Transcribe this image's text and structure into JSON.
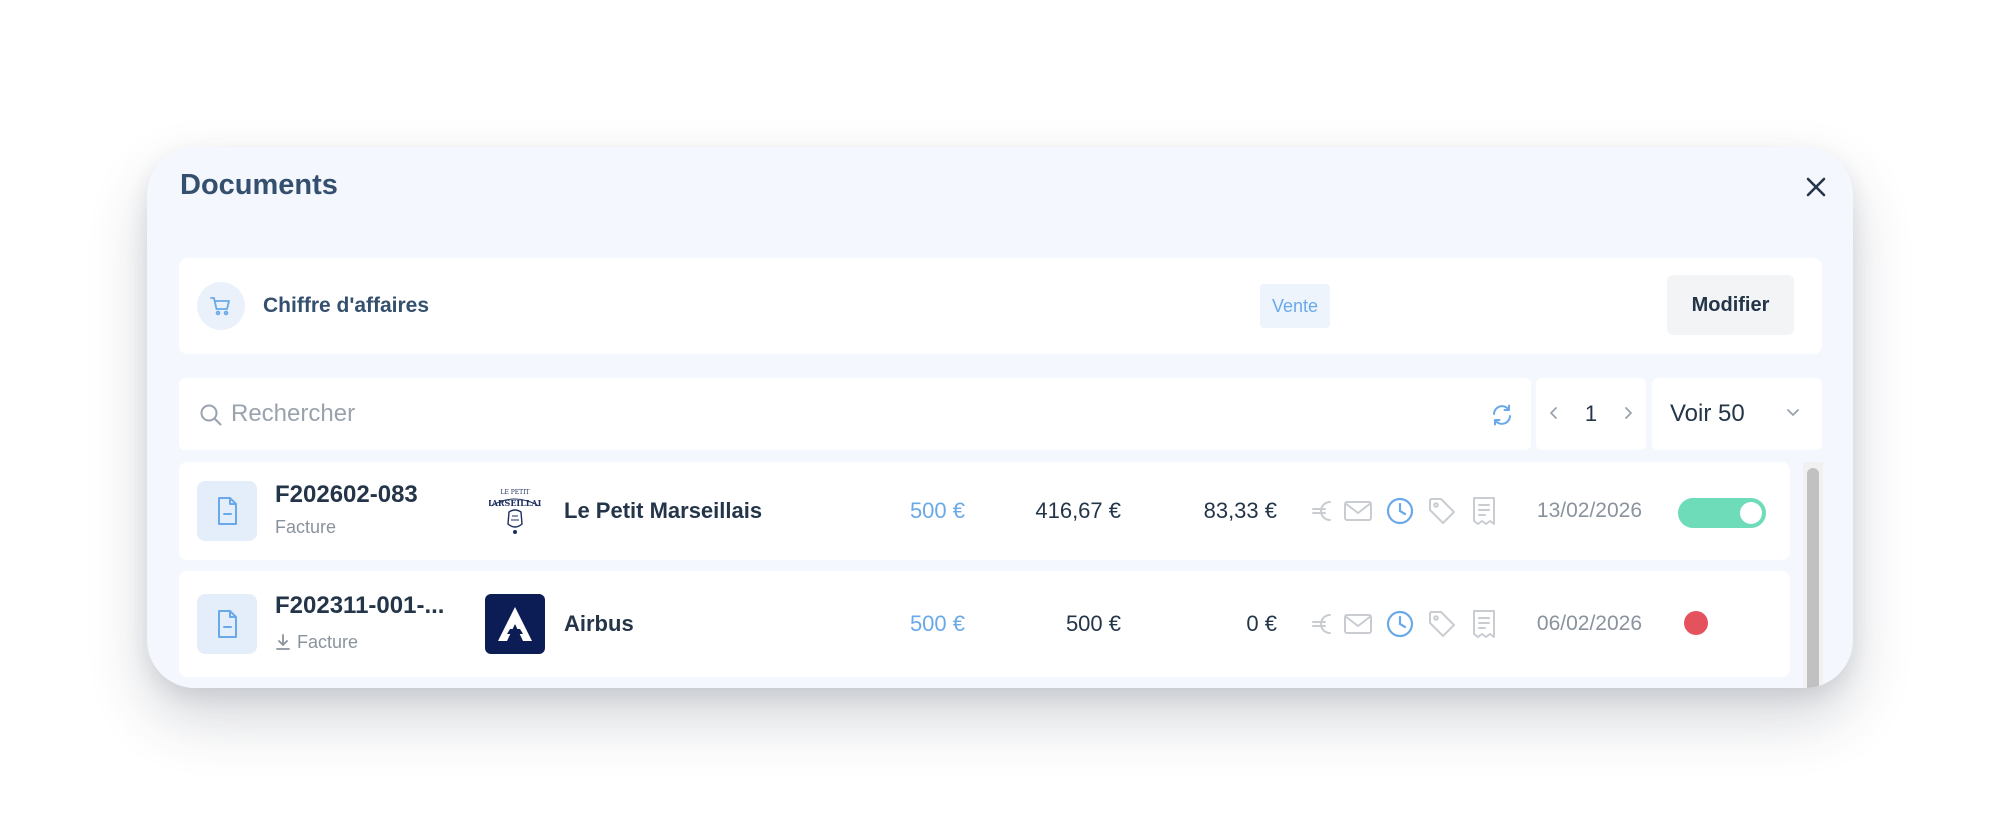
{
  "modal": {
    "title": "Documents"
  },
  "category": {
    "label": "Chiffre d'affaires",
    "badge": "Vente",
    "edit_label": "Modifier"
  },
  "search": {
    "placeholder": "Rechercher",
    "value": ""
  },
  "pagination": {
    "page": "1"
  },
  "per_page": {
    "label": "Voir 50"
  },
  "colors": {
    "accent": "#6aa9e9",
    "title": "#34506e",
    "text": "#24354a",
    "muted": "#8a939d",
    "toggle_on": "#6fdcb9",
    "status_error": "#e4525d",
    "airbus_brand": "#0c1d56"
  },
  "documents": [
    {
      "number": "F202602-083",
      "type": "Facture",
      "client": "Le Petit Marseillais",
      "client_logo_text": "LE PETIT MARSEILLAIS",
      "amount_ttc": "500 €",
      "amount_ht": "416,67 €",
      "amount_tva": "83,33 €",
      "actions": [
        "euro-icon",
        "mail-icon",
        "clock-icon",
        "tag-icon",
        "receipt-icon"
      ],
      "date": "13/02/2026",
      "status": "toggle-on"
    },
    {
      "number": "F202311-001-...",
      "type": "Facture",
      "client": "Airbus",
      "amount_ttc": "500 €",
      "amount_ht": "500 €",
      "amount_tva": "0 €",
      "actions": [
        "euro-icon",
        "mail-icon",
        "clock-icon",
        "tag-icon",
        "receipt-icon"
      ],
      "date": "06/02/2026",
      "status": "error-dot"
    }
  ]
}
